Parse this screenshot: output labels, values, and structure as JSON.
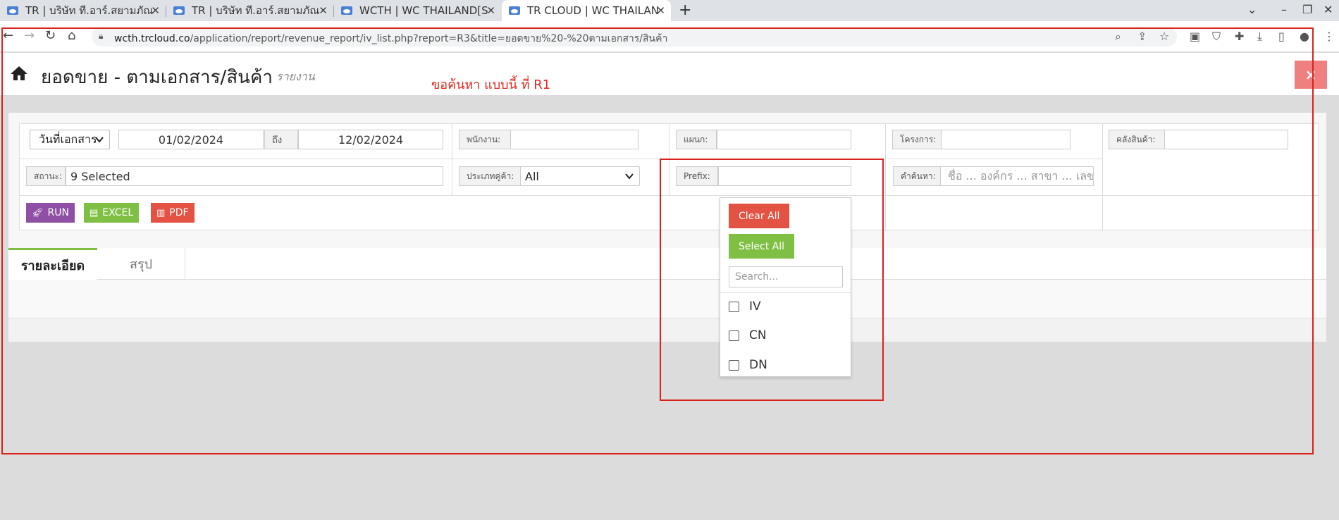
{
  "browser": {
    "tabs": [
      {
        "title": "TR | บริษัท ที.อาร์.สยามภัณ"
      },
      {
        "title": "TR | บริษัท ที.อาร์.สยามภัณ"
      },
      {
        "title": "WCTH | WC THAILAND[S"
      },
      {
        "title": "TR CLOUD | WC THAILAN"
      }
    ],
    "url_domain": "wcth.trcloud.co",
    "url_path": "/application/report/revenue_report/iv_list.php?report=R3&title=ยอดขาย%20-%20ตามเอกสาร/สินค้า"
  },
  "page": {
    "title": "ยอดขาย - ตามเอกสาร/สินค้า",
    "subtitle": "รายงาน",
    "note": "ขอค้นหา แบบนี้ ที่ R1",
    "close_label": "×"
  },
  "filters": {
    "date_type": "วันที่เอกสาร",
    "date_from": "01/02/2024",
    "to_label": "ถึง",
    "date_to": "12/02/2024",
    "employee_label": "พนักงาน:",
    "employee_value": "",
    "department_label": "แผนก:",
    "department_value": "",
    "project_label": "โครงการ:",
    "project_value": "",
    "warehouse_label": "คลังสินค้า:",
    "warehouse_value": "",
    "status_label": "สถานะ:",
    "status_value": "9 Selected",
    "partner_type_label": "ประเภทคู่ค้า:",
    "partner_type_value": "All",
    "prefix_label": "Prefix:",
    "prefix_value": "",
    "keyword_label": "คำค้นหา:",
    "keyword_placeholder": "ชื่อ ... องค์กร ... สาขา ... เลขเ"
  },
  "actions": {
    "run": "RUN",
    "excel": "EXCEL",
    "pdf": "PDF"
  },
  "tabs": {
    "detail": "รายละเอียด",
    "summary": "สรุป"
  },
  "prefix_dropdown": {
    "clear_all": "Clear All",
    "select_all": "Select All",
    "search_placeholder": "Search...",
    "options": [
      "IV",
      "CN",
      "DN"
    ]
  },
  "colors": {
    "run": "#8e4fa5",
    "excel": "#7fbf44",
    "pdf": "#e45243",
    "annotation": "#d9221c"
  }
}
